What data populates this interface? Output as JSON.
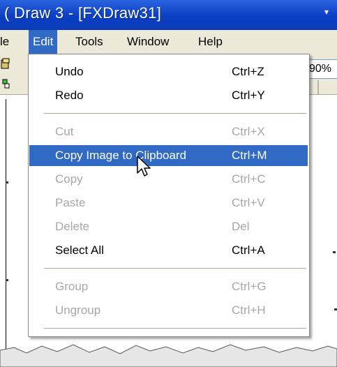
{
  "window": {
    "title": "( Draw 3 - [FXDraw31]",
    "title_button": "▾"
  },
  "menubar": [
    {
      "label": "le",
      "active": false
    },
    {
      "label": "Edit",
      "active": true
    },
    {
      "label": "Tools",
      "active": false
    },
    {
      "label": "Window",
      "active": false
    },
    {
      "label": "Help",
      "active": false
    }
  ],
  "toolbar": {
    "zoom": "90%"
  },
  "edit_menu": {
    "items": [
      {
        "label": "Undo",
        "shortcut": "Ctrl+Z",
        "enabled": true
      },
      {
        "label": "Redo",
        "shortcut": "Ctrl+Y",
        "enabled": true
      },
      {
        "label": "Cut",
        "shortcut": "Ctrl+X",
        "enabled": false
      },
      {
        "label": "Copy Image to Clipboard",
        "shortcut": "Ctrl+M",
        "enabled": true,
        "highlighted": true
      },
      {
        "label": "Copy",
        "shortcut": "Ctrl+C",
        "enabled": false
      },
      {
        "label": "Paste",
        "shortcut": "Ctrl+V",
        "enabled": false
      },
      {
        "label": "Delete",
        "shortcut": "Del",
        "enabled": false
      },
      {
        "label": "Select All",
        "shortcut": "Ctrl+A",
        "enabled": true
      },
      {
        "label": "Group",
        "shortcut": "Ctrl+G",
        "enabled": false
      },
      {
        "label": "Ungroup",
        "shortcut": "Ctrl+H",
        "enabled": false
      }
    ]
  },
  "colors": {
    "titlebar": "#0a3fc4",
    "menu_highlight": "#316ac5",
    "disabled_text": "#a7a6aa",
    "menubar_bg": "#ece9d8"
  },
  "icons": {
    "cursor": "arrow-pointer-icon"
  }
}
